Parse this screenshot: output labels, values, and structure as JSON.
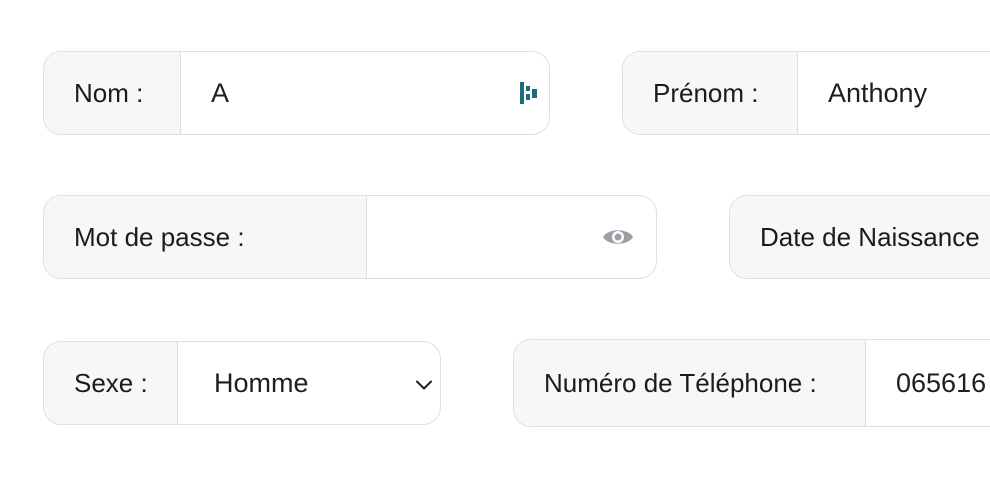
{
  "form": {
    "nom": {
      "label": "Nom :",
      "value": "A",
      "icon": "dashlane-icon"
    },
    "prenom": {
      "label": "Prénom :",
      "value": "Anthony"
    },
    "mot_de_passe": {
      "label": "Mot de passe :",
      "value": "",
      "icon": "eye-icon"
    },
    "date_naissance": {
      "label": "Date de Naissance"
    },
    "sexe": {
      "label": "Sexe :",
      "value": "Homme",
      "icon": "chevron-down-icon"
    },
    "telephone": {
      "label": "Numéro de Téléphone :",
      "value": "065616"
    }
  },
  "colors": {
    "label_bg": "#f7f7f8",
    "border": "#dedfe1",
    "dashlane_icon": "#1b6b7a",
    "eye_icon": "#9aa0a6"
  }
}
